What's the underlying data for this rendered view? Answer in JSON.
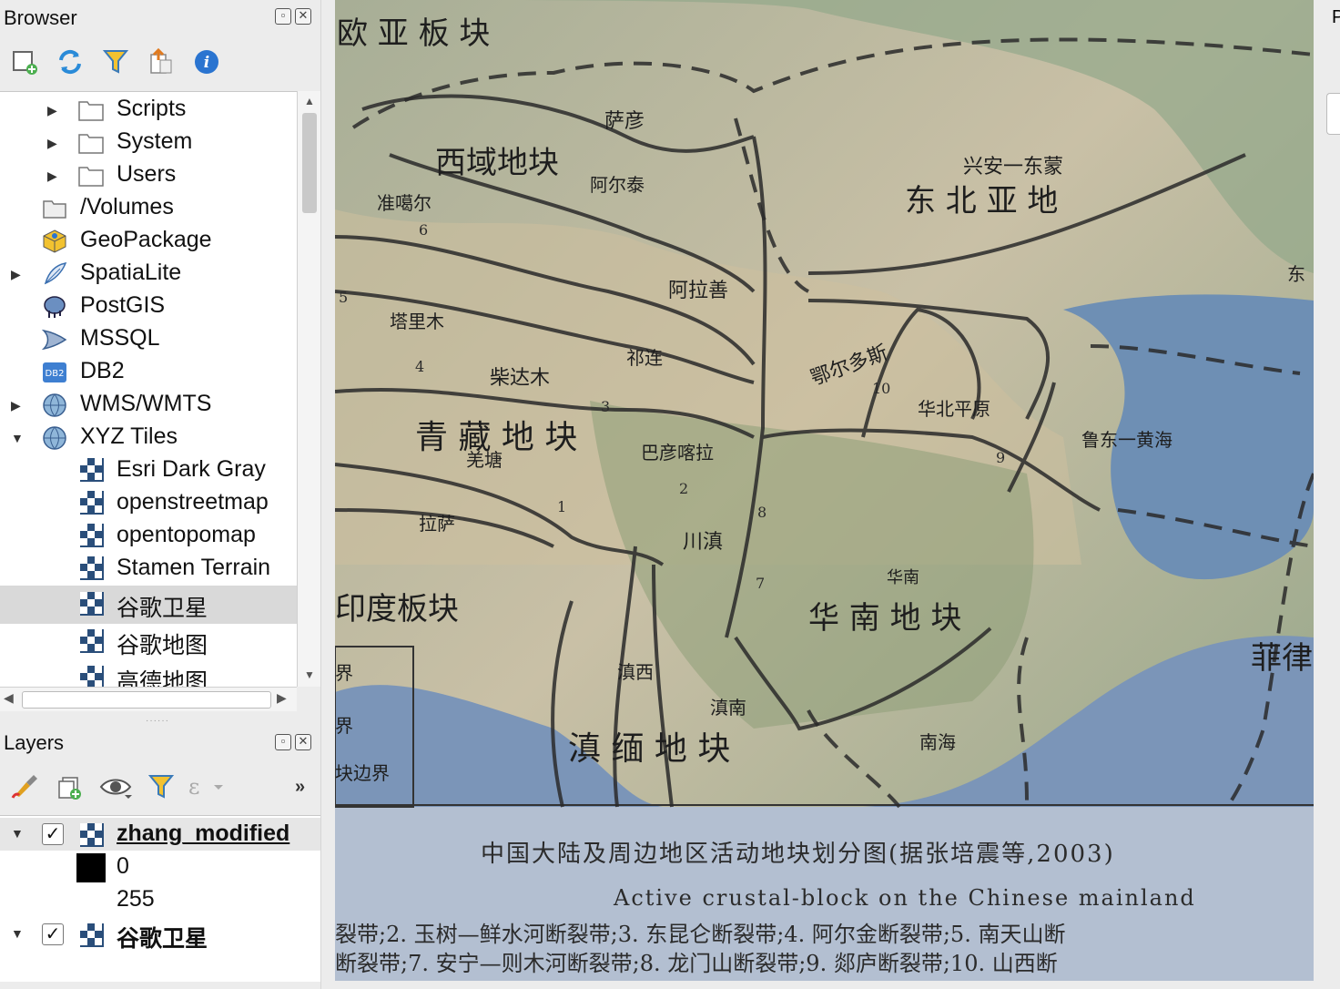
{
  "browser": {
    "title": "Browser",
    "items": [
      {
        "label": "Scripts",
        "icon": "folder-icon",
        "arrow": "right"
      },
      {
        "label": "System",
        "icon": "folder-icon",
        "arrow": "right"
      },
      {
        "label": "Users",
        "icon": "folder-icon",
        "arrow": "right"
      },
      {
        "label": "/Volumes",
        "icon": "volumes-icon",
        "arrow": ""
      },
      {
        "label": "GeoPackage",
        "icon": "geopackage-icon",
        "arrow": ""
      },
      {
        "label": "SpatiaLite",
        "icon": "spatialite-icon",
        "arrow": "right"
      },
      {
        "label": "PostGIS",
        "icon": "postgis-icon",
        "arrow": ""
      },
      {
        "label": "MSSQL",
        "icon": "mssql-icon",
        "arrow": ""
      },
      {
        "label": "DB2",
        "icon": "db2-icon",
        "arrow": ""
      },
      {
        "label": "WMS/WMTS",
        "icon": "globe-icon",
        "arrow": "right"
      },
      {
        "label": "XYZ Tiles",
        "icon": "globe-icon",
        "arrow": "down"
      },
      {
        "label": "Esri Dark Gray",
        "icon": "xyz-tile-icon",
        "arrow": ""
      },
      {
        "label": "openstreetmap",
        "icon": "xyz-tile-icon",
        "arrow": ""
      },
      {
        "label": "opentopomap",
        "icon": "xyz-tile-icon",
        "arrow": ""
      },
      {
        "label": "Stamen Terrain",
        "icon": "xyz-tile-icon",
        "arrow": ""
      },
      {
        "label": "谷歌卫星",
        "icon": "xyz-tile-icon",
        "arrow": "",
        "selected": true
      },
      {
        "label": "谷歌地图",
        "icon": "xyz-tile-icon",
        "arrow": ""
      },
      {
        "label": "高德地图",
        "icon": "xyz-tile-icon",
        "arrow": ""
      }
    ]
  },
  "layers": {
    "title": "Layers",
    "overflow_label": "»",
    "items": [
      {
        "name": "zhang_modified",
        "checked": "✓",
        "expanded": true
      },
      {
        "legend_value_low": "0",
        "legend_value_high": "255"
      },
      {
        "name": "谷歌卫星",
        "checked": "✓",
        "expanded": true
      }
    ]
  },
  "map": {
    "labels_cn": {
      "top": "欧 亚 板 块",
      "saeyan": "萨彦",
      "xiyu": "西域地块",
      "altai": "阿尔泰",
      "junggar": "准噶尔",
      "xinganmeng": "兴安一东蒙",
      "dongbeiya": "东 北 亚 地",
      "alashan": "阿拉善",
      "tarim": "塔里木",
      "qilian": "祁连",
      "qaidam": "柴达木",
      "ordos": "鄂尔多斯",
      "huabei": "华北平原",
      "ludong": "鲁东一黄海",
      "qingzang": "青 藏 地 块",
      "qiangtang": "羌塘",
      "bayankala": "巴彦喀拉",
      "lasa": "拉萨",
      "chuandian": "川滇",
      "huanan_small": "华南",
      "huanan": "华 南 地 块",
      "india": "印度板块",
      "dianxi": "滇西",
      "diannan": "滇南",
      "dianmian": "滇 缅 地 块",
      "nanhai": "南海",
      "philippines": "菲律",
      "dong": "东",
      "jie1": "界",
      "jie2": "界",
      "kuaibianjie": "块边界"
    },
    "caption_cn": "中国大陆及周边地区活动地块划分图(据张培震等,2003)",
    "caption_en": "Active crustal-block on the Chinese mainland",
    "legend_line1": "裂带;2. 玉树—鲜水河断裂带;3. 东昆仑断裂带;4. 阿尔金断裂带;5. 南天山断",
    "legend_line2": "断裂带;7. 安宁—则木河断裂带;8. 龙门山断裂带;9. 郯庐断裂带;10. 山西断",
    "numbers": [
      "6",
      "5",
      "4",
      "3",
      "2",
      "1",
      "8",
      "7",
      "9",
      "10"
    ]
  },
  "right_panel": {
    "initial": "P"
  }
}
